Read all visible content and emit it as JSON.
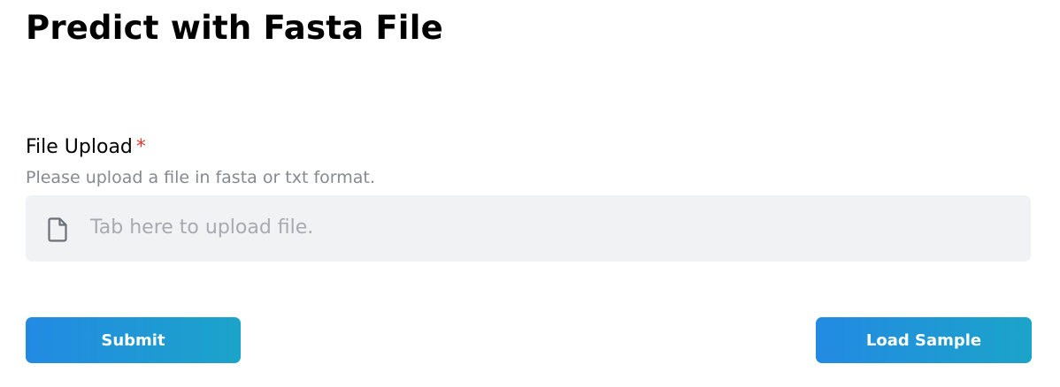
{
  "page": {
    "title": "Predict with Fasta File"
  },
  "form": {
    "file_upload": {
      "label": "File Upload",
      "required_marker": "*",
      "hint": "Please upload a file in fasta or txt format.",
      "placeholder": "Tab here to upload file.",
      "icon": "file-icon"
    },
    "submit_label": "Submit",
    "load_sample_label": "Load Sample"
  },
  "colors": {
    "button_gradient_start": "#238ae3",
    "button_gradient_end": "#1ba4c9",
    "required": "#e53935",
    "upload_background": "#f1f2f4"
  }
}
